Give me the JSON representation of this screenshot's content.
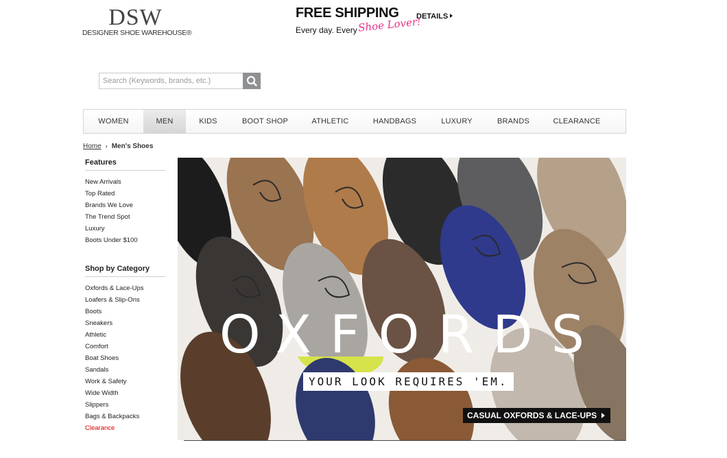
{
  "logo": {
    "mark": "DSW",
    "sub": "DESIGNER SHOE WAREHOUSE®"
  },
  "promo": {
    "headline": "FREE SHIPPING",
    "details": "DETAILS",
    "sub": "Every day. Every",
    "script": "Shoe Lover!",
    "script_color": "#e8328b"
  },
  "search": {
    "placeholder": "Search (Keywords, brands, etc.)",
    "icon": "search-icon"
  },
  "nav": {
    "items": [
      "WOMEN",
      "MEN",
      "KIDS",
      "BOOT SHOP",
      "ATHLETIC",
      "HANDBAGS",
      "LUXURY",
      "BRANDS",
      "CLEARANCE"
    ],
    "active": "MEN"
  },
  "breadcrumb": {
    "home": "Home",
    "separator": "›",
    "current": "Men's Shoes"
  },
  "sidebar": {
    "features": {
      "heading": "Features",
      "items": [
        "New Arrivals",
        "Top Rated",
        "Brands We Love",
        "The Trend Spot",
        "Luxury",
        "Boots Under $100"
      ]
    },
    "categories": {
      "heading": "Shop by Category",
      "items": [
        "Oxfords & Lace-Ups",
        "Loafers & Slip-Ons",
        "Boots",
        "Sneakers",
        "Athletic",
        "Comfort",
        "Boat Shoes",
        "Sandals",
        "Work & Safety",
        "Wide Width",
        "Slippers",
        "Bags & Backpacks",
        "Clearance"
      ],
      "highlight_color": "#d40000"
    }
  },
  "hero": {
    "title": "OXFORDS",
    "tagline": "YOUR LOOK REQUIRES 'EM.",
    "cta": "CASUAL OXFORDS & LACE-UPS"
  }
}
